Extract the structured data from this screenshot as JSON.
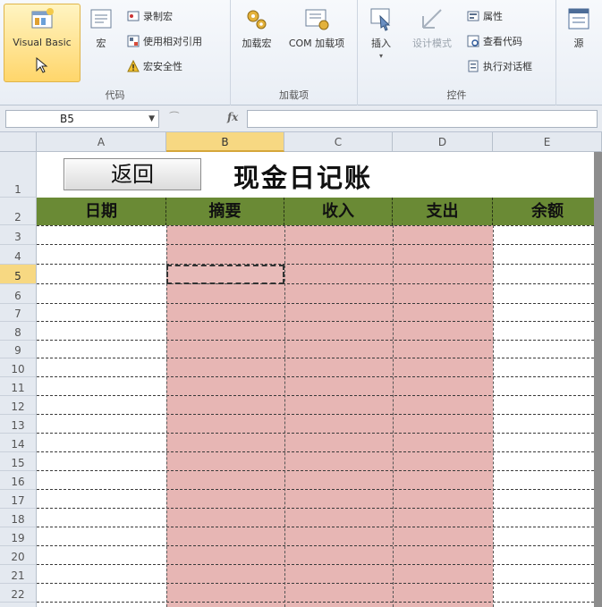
{
  "ribbon": {
    "code_group": {
      "label": "代码",
      "visual_basic": "Visual Basic",
      "macros": "宏",
      "record_macro": "录制宏",
      "relative_ref": "使用相对引用",
      "macro_security": "宏安全性"
    },
    "addins_group": {
      "label": "加载项",
      "addins": "加载宏",
      "com_addins": "COM 加载项"
    },
    "controls_group": {
      "label": "控件",
      "insert": "插入",
      "design_mode": "设计模式",
      "properties": "属性",
      "view_code": "查看代码",
      "run_dialog": "执行对话框"
    },
    "xml_group": {
      "source": "源"
    }
  },
  "formula_bar": {
    "name_box": "B5",
    "fx": "fx",
    "formula": ""
  },
  "sheet": {
    "columns": [
      "A",
      "B",
      "C",
      "D",
      "E"
    ],
    "rows": [
      "1",
      "2",
      "3",
      "4",
      "5",
      "6",
      "7",
      "8",
      "9",
      "10",
      "11",
      "12",
      "13",
      "14",
      "15",
      "16",
      "17",
      "18",
      "19",
      "20",
      "21",
      "22"
    ],
    "active_cell": "B5",
    "back_button": "返回",
    "title": "现金日记账",
    "headers": [
      "日期",
      "摘要",
      "收入",
      "支出",
      "余额"
    ],
    "colors": {
      "header_fill": "#6a8a35",
      "pink_fill": "#e7b6b4",
      "active_header": "#f7d882"
    }
  }
}
